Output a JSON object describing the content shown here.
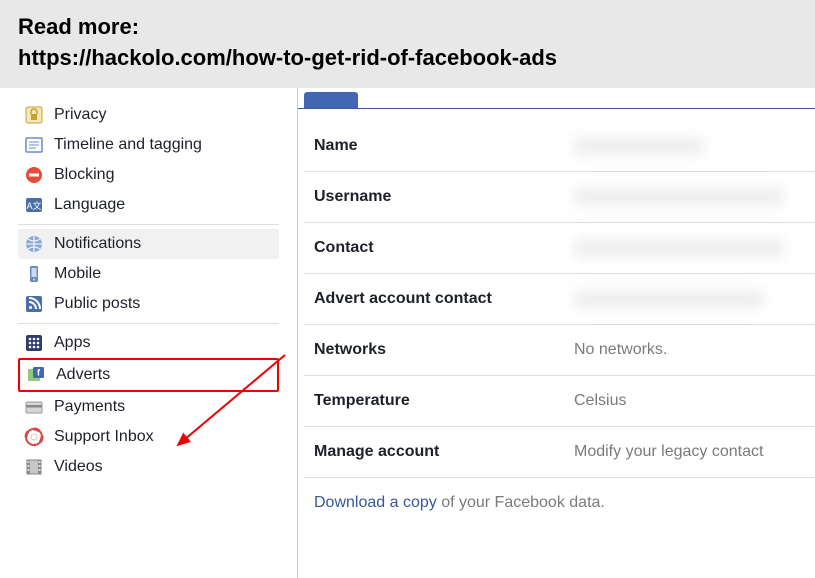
{
  "banner": {
    "line1": "Read more:",
    "line2": "https://hackolo.com/how-to-get-rid-of-facebook-ads"
  },
  "sidebar": {
    "group1": [
      {
        "icon": "lock-icon",
        "label": "Privacy"
      },
      {
        "icon": "timeline-icon",
        "label": "Timeline and tagging"
      },
      {
        "icon": "block-icon",
        "label": "Blocking"
      },
      {
        "icon": "language-icon",
        "label": "Language"
      }
    ],
    "group2": [
      {
        "icon": "globe-icon",
        "label": "Notifications",
        "selected": true
      },
      {
        "icon": "mobile-icon",
        "label": "Mobile"
      },
      {
        "icon": "rss-icon",
        "label": "Public posts"
      }
    ],
    "group3": [
      {
        "icon": "apps-icon",
        "label": "Apps"
      },
      {
        "icon": "adverts-icon",
        "label": "Adverts",
        "highlighted": true
      },
      {
        "icon": "payments-icon",
        "label": "Payments"
      },
      {
        "icon": "support-icon",
        "label": "Support Inbox"
      },
      {
        "icon": "videos-icon",
        "label": "Videos"
      }
    ]
  },
  "settings": {
    "rows": [
      {
        "label": "Name",
        "value_type": "blur",
        "blur_width": 130
      },
      {
        "label": "Username",
        "value_type": "blur",
        "blur_width": 210
      },
      {
        "label": "Contact",
        "value_type": "blur",
        "blur_width": 210
      },
      {
        "label": "Advert account contact",
        "value_type": "blur",
        "blur_width": 190
      },
      {
        "label": "Networks",
        "value": "No networks."
      },
      {
        "label": "Temperature",
        "value": "Celsius"
      },
      {
        "label": "Manage account",
        "value": "Modify your legacy contact "
      }
    ],
    "download": {
      "link": "Download a copy",
      "rest": " of your Facebook data."
    }
  }
}
